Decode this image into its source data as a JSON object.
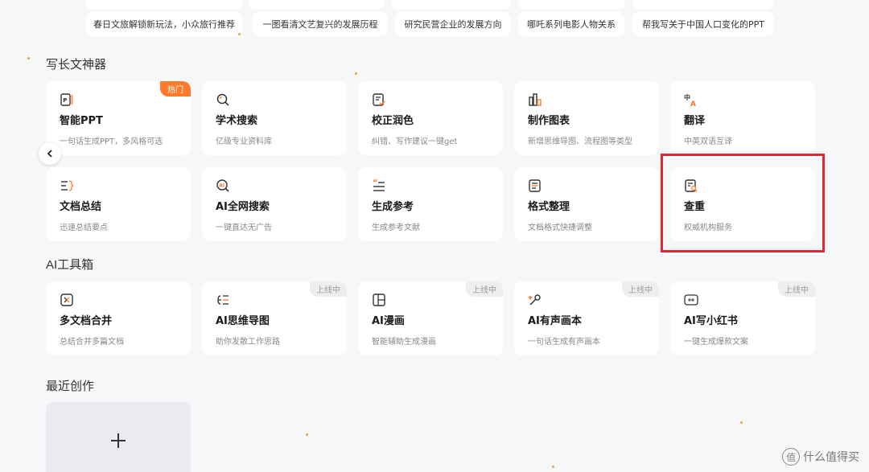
{
  "suggestions": [
    "春日文旅解锁新玩法，小众旅行推荐",
    "一图看清文艺复兴的发展历程",
    "研究民营企业的发展方向",
    "哪吒系列电影人物关系",
    "帮我写关于中国人口变化的PPT"
  ],
  "writing_section": {
    "title": "写长文神器",
    "hot_badge": "热门",
    "cards": [
      {
        "name": "智能PPT",
        "desc": "一句话生成PPT，多风格可选",
        "icon": "ppt-icon"
      },
      {
        "name": "学术搜索",
        "desc": "亿级专业资料库",
        "icon": "search-icon"
      },
      {
        "name": "校正润色",
        "desc": "纠错、写作建议一键get",
        "icon": "edit-doc-icon"
      },
      {
        "name": "制作图表",
        "desc": "新增思维导图、流程图等类型",
        "icon": "chart-icon"
      },
      {
        "name": "翻译",
        "desc": "中英双语互译",
        "icon": "translate-icon"
      },
      {
        "name": "文档总结",
        "desc": "迅速总结要点",
        "icon": "summary-icon"
      },
      {
        "name": "AI全网搜索",
        "desc": "一键直达无广告",
        "icon": "ai-search-icon"
      },
      {
        "name": "生成参考",
        "desc": "生成参考文献",
        "icon": "reference-icon"
      },
      {
        "name": "格式整理",
        "desc": "文档格式快捷调整",
        "icon": "format-icon"
      },
      {
        "name": "查重",
        "desc": "权威机构服务",
        "icon": "plagiarism-check-icon"
      }
    ]
  },
  "tools_section": {
    "title": "AI工具箱",
    "soon_badge": "上线中",
    "cards": [
      {
        "name": "多文档合并",
        "desc": "总结合并多篇文档",
        "icon": "merge-icon"
      },
      {
        "name": "AI思维导图",
        "desc": "助你发散工作思路",
        "icon": "mindmap-icon"
      },
      {
        "name": "AI漫画",
        "desc": "智能辅助生成漫画",
        "icon": "comic-icon"
      },
      {
        "name": "AI有声画本",
        "desc": "一句话生成有声画本",
        "icon": "audiobook-icon"
      },
      {
        "name": "AI写小红书",
        "desc": "一键生成爆款文案",
        "icon": "xiaohongshu-icon"
      }
    ]
  },
  "recent_section": {
    "title": "最近创作",
    "new_label": "+"
  },
  "watermark": {
    "logo": "值",
    "text": "什么值得买"
  },
  "colors": {
    "accent": "#ff7a2a",
    "highlight": "#e3262f",
    "background": "#f6f7f9"
  }
}
